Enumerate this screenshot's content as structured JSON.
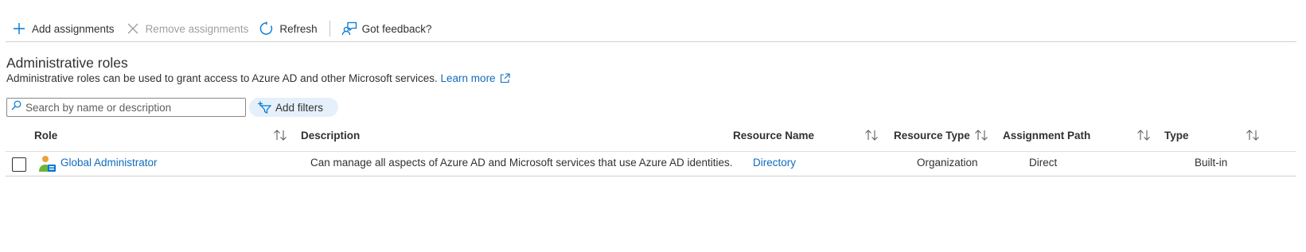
{
  "toolbar": {
    "add_label": "Add assignments",
    "remove_label": "Remove assignments",
    "refresh_label": "Refresh",
    "feedback_label": "Got feedback?"
  },
  "page": {
    "title": "Administrative roles",
    "description": "Administrative roles can be used to grant access to Azure AD and other Microsoft services.",
    "learn_more": "Learn more"
  },
  "search": {
    "placeholder": "Search by name or description"
  },
  "filters": {
    "add_label": "Add filters"
  },
  "table": {
    "columns": {
      "role": "Role",
      "description": "Description",
      "resource_name": "Resource Name",
      "resource_type": "Resource Type",
      "assignment_path": "Assignment Path",
      "type": "Type"
    },
    "rows": [
      {
        "role": "Global Administrator",
        "description": "Can manage all aspects of Azure AD and Microsoft services that use Azure AD identities.",
        "resource_name": "Directory",
        "resource_type": "Organization",
        "assignment_path": "Direct",
        "type": "Built-in"
      }
    ]
  },
  "colors": {
    "link": "#0f6cbd",
    "accent": "#0078d4",
    "filter_bg": "#e6f0fa"
  },
  "icons": [
    "plus-icon",
    "close-icon",
    "refresh-icon",
    "feedback-icon",
    "external-link-icon",
    "search-icon",
    "filter-icon",
    "sort-icon",
    "role-user-icon"
  ]
}
